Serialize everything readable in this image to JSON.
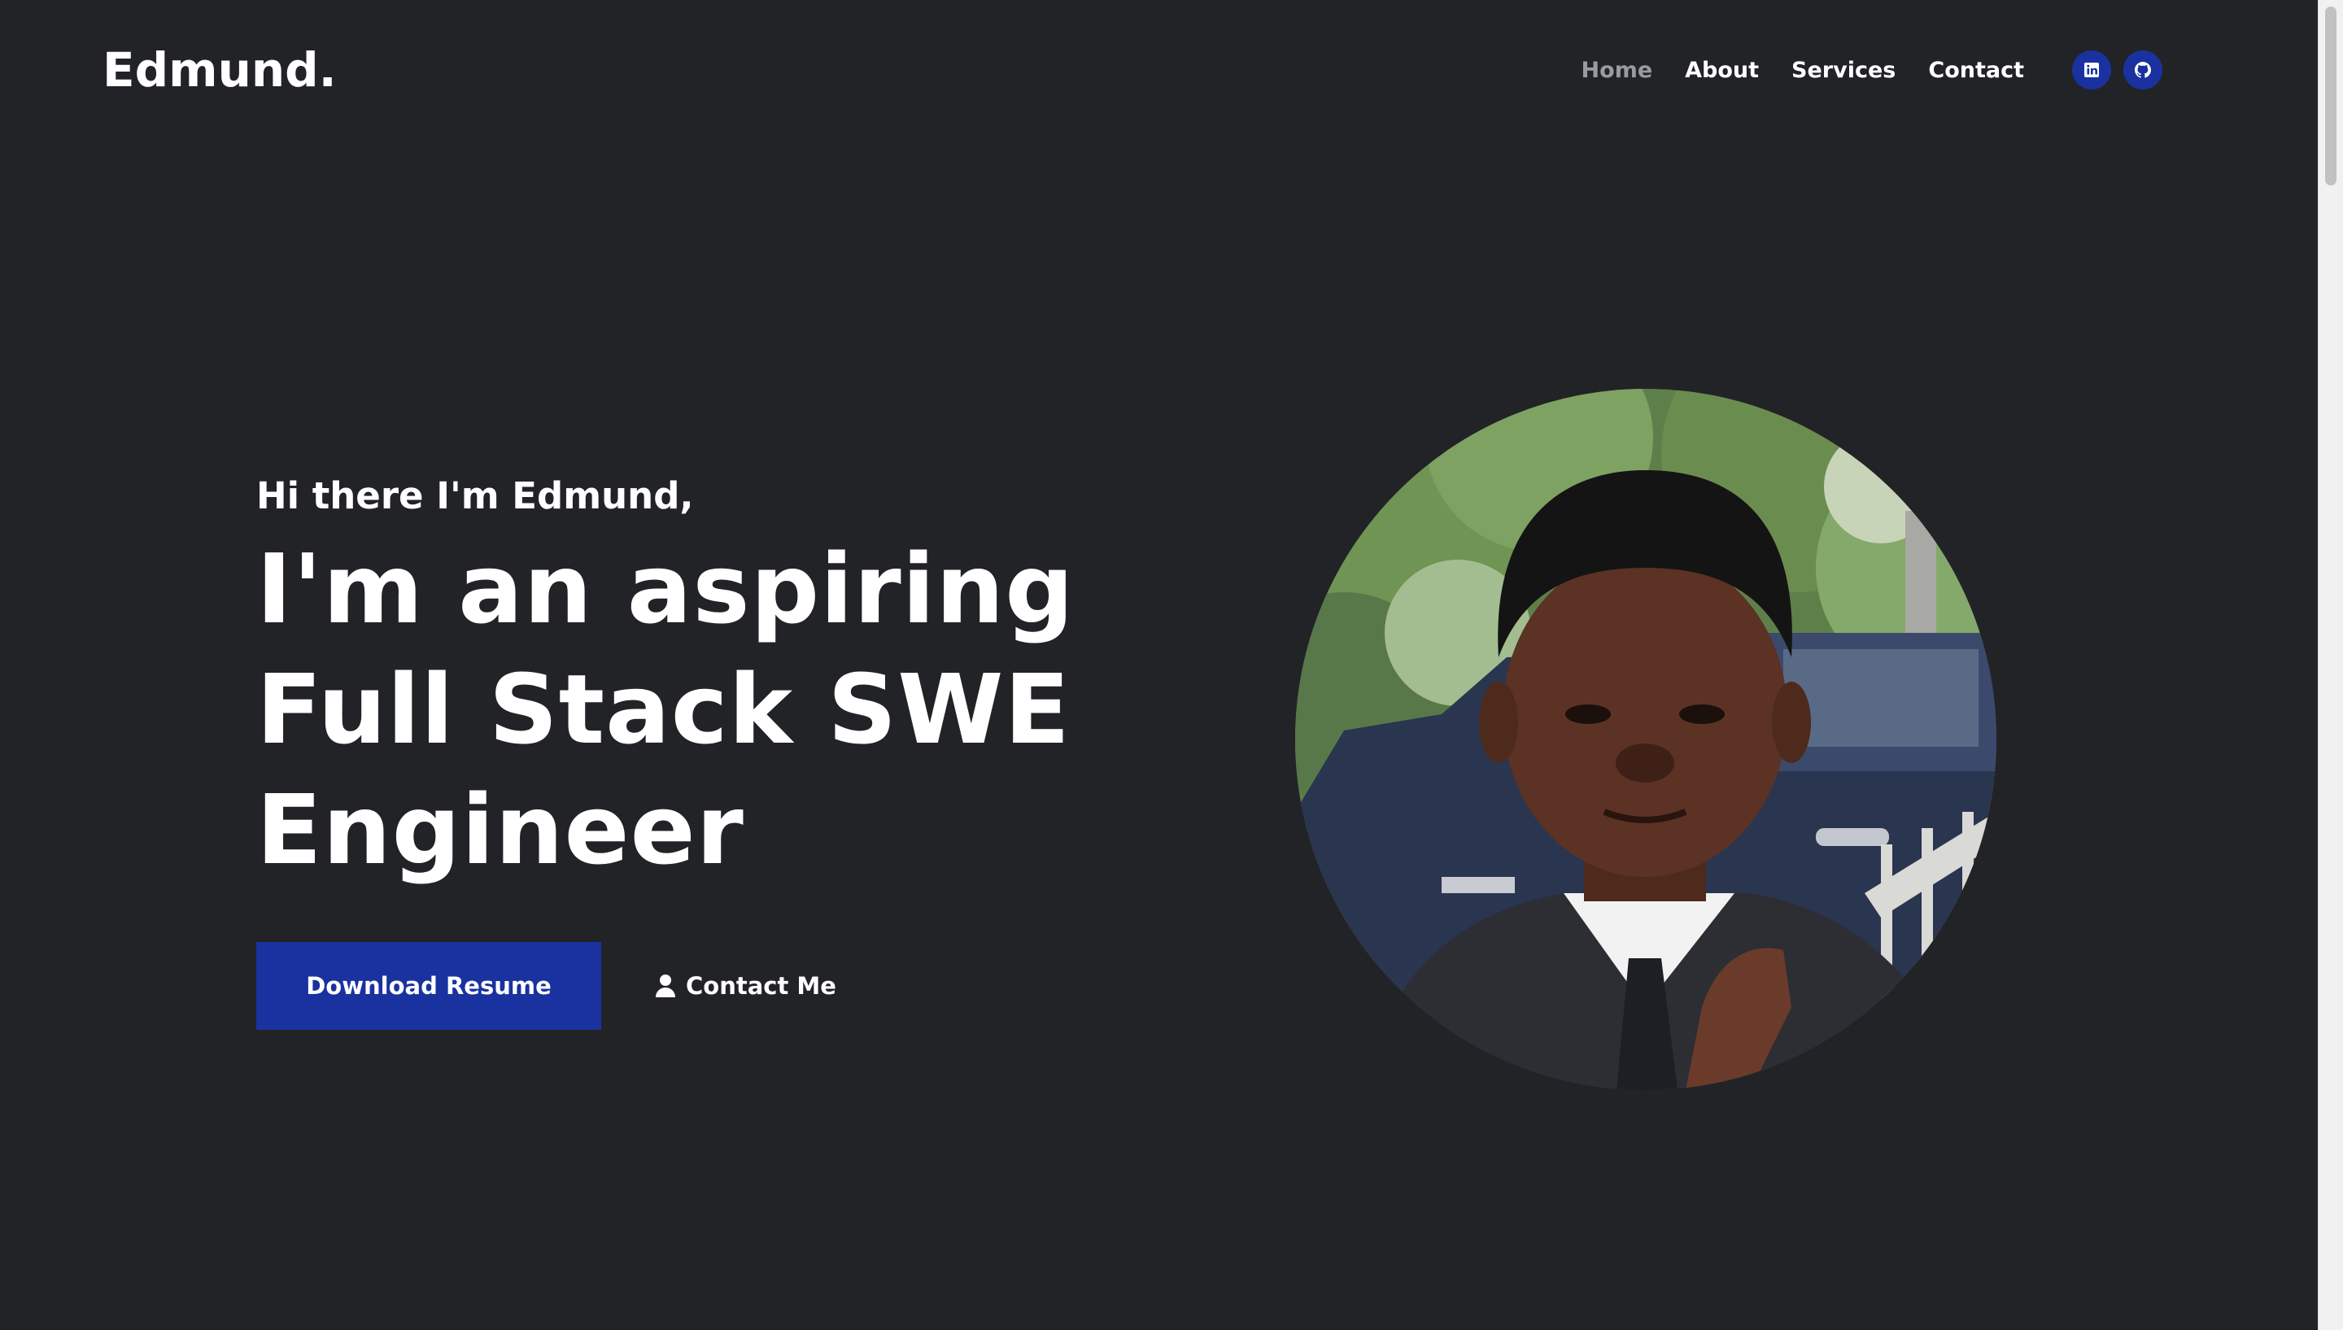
{
  "brand": {
    "logo": "Edmund."
  },
  "nav": {
    "items": [
      {
        "label": "Home",
        "active": true
      },
      {
        "label": "About",
        "active": false
      },
      {
        "label": "Services",
        "active": false
      },
      {
        "label": "Contact",
        "active": false
      }
    ],
    "socials": [
      {
        "icon": "linkedin-icon"
      },
      {
        "icon": "github-icon"
      }
    ]
  },
  "hero": {
    "greeting": "Hi there I'm Edmund,",
    "headline_lines": [
      "I'm an aspiring",
      "Full Stack SWE",
      "Engineer"
    ],
    "primary_button": "Download Resume",
    "secondary_button": "Contact Me",
    "secondary_icon": "user-icon",
    "portrait_alt": "portrait-image"
  },
  "colors": {
    "background": "#222327",
    "accent": "#1a32a0",
    "text": "#ffffff",
    "nav_active": "#9a9ba2"
  }
}
